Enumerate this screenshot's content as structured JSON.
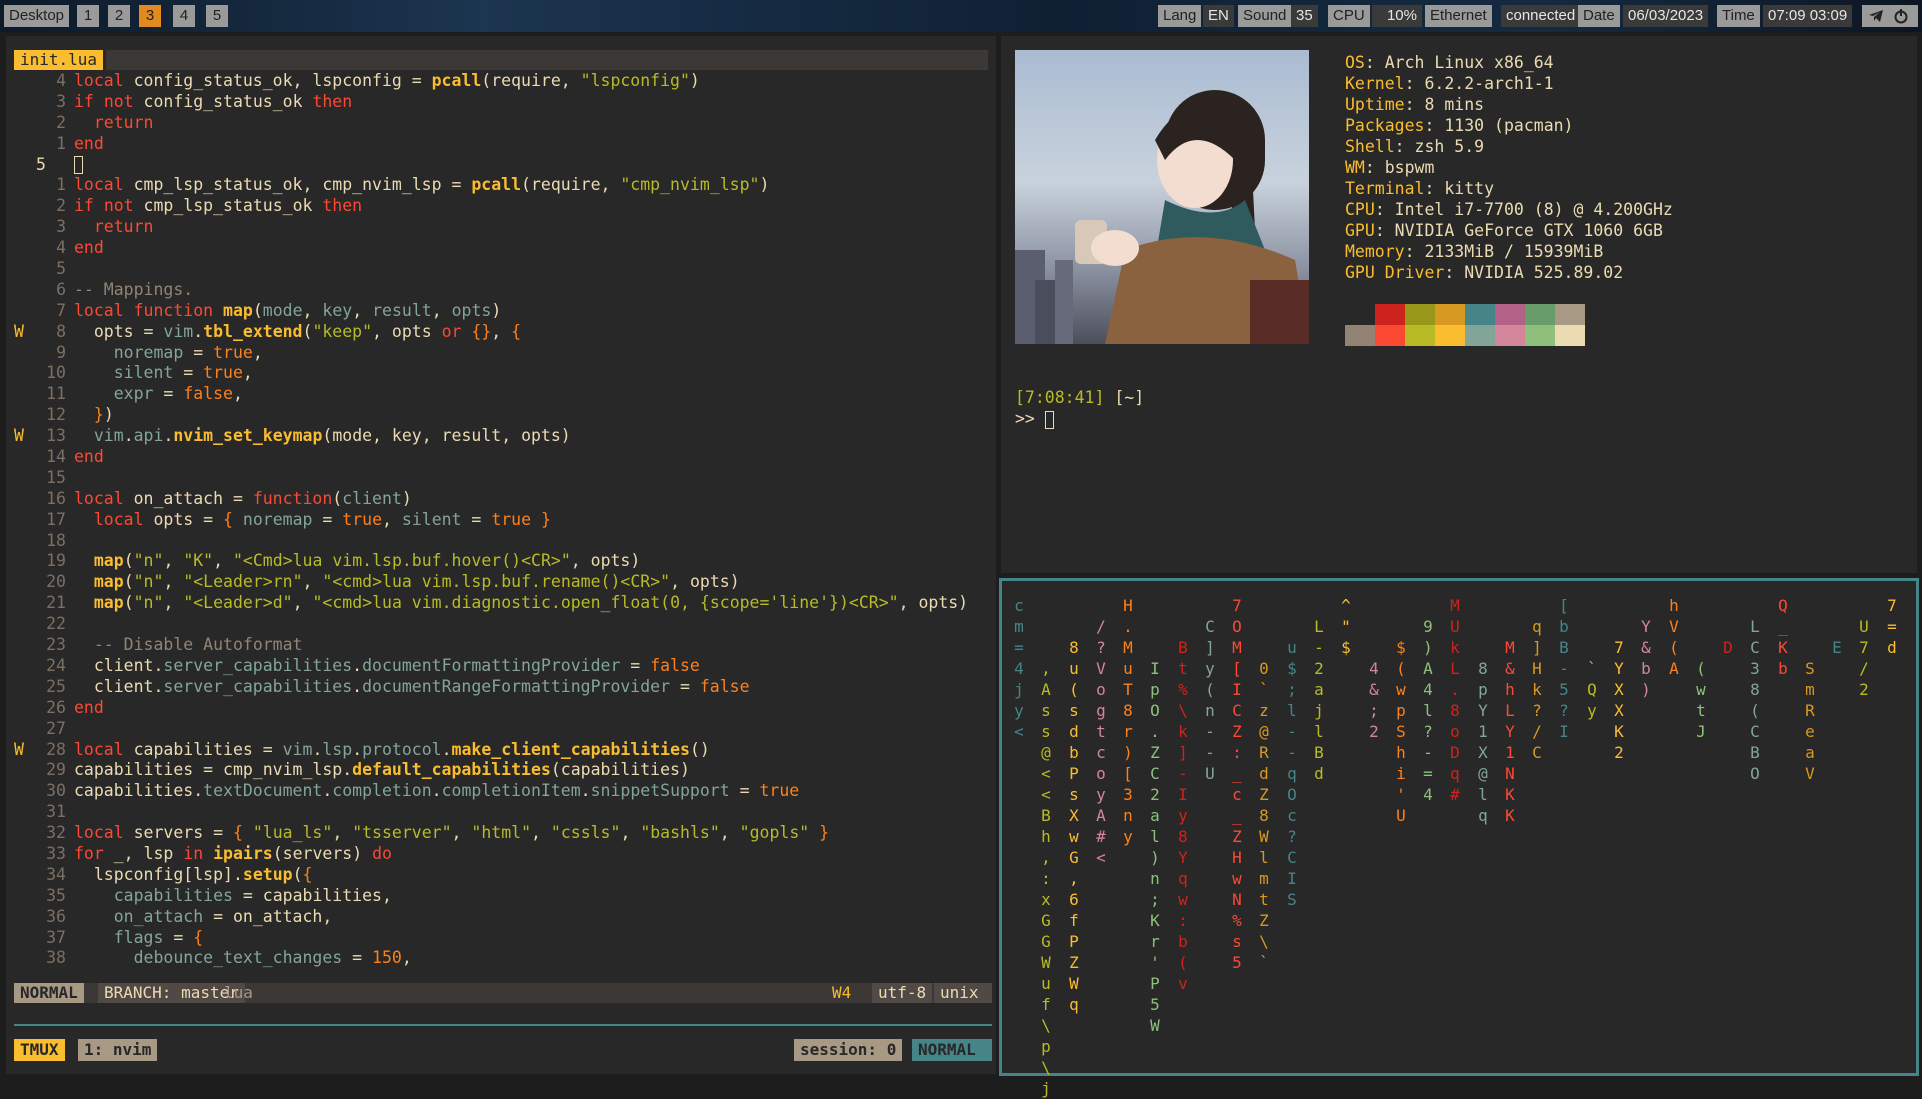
{
  "topbar": {
    "desktop_label": "Desktop",
    "workspaces": [
      "1",
      "2",
      "3",
      "4",
      "5"
    ],
    "active_workspace": "3",
    "lang_label": "Lang",
    "lang_value": "EN",
    "sound_label": "Sound",
    "sound_value": "35",
    "cpu_label": "CPU",
    "cpu_value": "10%",
    "net_label": "Ethernet",
    "net_value": "connected",
    "date_label": "Date",
    "date_value": "06/03/2023",
    "time_label": "Time",
    "time_value": "07:09 03:09",
    "tray_icons": [
      "telegram-icon",
      "power-icon"
    ]
  },
  "editor": {
    "tab_name": "init.lua",
    "lines": [
      {
        "sign": "",
        "num": "4",
        "html": "<span class='k'>local</span> config_status_ok, lspconfig = <span class='f'>pcall</span>(require, <span class='s'>\"lspconfig\"</span>)"
      },
      {
        "sign": "",
        "num": "3",
        "html": "<span class='k'>if</span> <span class='k'>not</span> config_status_ok <span class='k'>then</span>"
      },
      {
        "sign": "",
        "num": "2",
        "html": "  <span class='k'>return</span>"
      },
      {
        "sign": "",
        "num": "1",
        "html": "<span class='k'>end</span>"
      },
      {
        "sign": "",
        "num": "5",
        "cur": true,
        "html": "<span class='cursor'></span>"
      },
      {
        "sign": "",
        "num": "1",
        "html": "<span class='k'>local</span> cmp_lsp_status_ok, cmp_nvim_lsp = <span class='f'>pcall</span>(require, <span class='s'>\"cmp_nvim_lsp\"</span>)"
      },
      {
        "sign": "",
        "num": "2",
        "html": "<span class='k'>if</span> <span class='k'>not</span> cmp_lsp_status_ok <span class='k'>then</span>"
      },
      {
        "sign": "",
        "num": "3",
        "html": "  <span class='k'>return</span>"
      },
      {
        "sign": "",
        "num": "4",
        "html": "<span class='k'>end</span>"
      },
      {
        "sign": "",
        "num": "5",
        "html": ""
      },
      {
        "sign": "",
        "num": "6",
        "html": "<span class='c'>-- Mappings.</span>"
      },
      {
        "sign": "",
        "num": "7",
        "html": "<span class='k'>local</span> <span class='k'>function</span> <span class='f'>map</span>(<span class='p'>mode</span>, <span class='p'>key</span>, <span class='p'>result</span>, <span class='p'>opts</span>)"
      },
      {
        "sign": "W",
        "num": "8",
        "html": "  opts = <span class='p'>vim</span>.<span class='f'>tbl_extend</span>(<span class='s'>\"keep\"</span>, opts <span class='k'>or</span> <span class='b'>{}</span>, <span class='b'>{</span>"
      },
      {
        "sign": "",
        "num": "9",
        "html": "    <span class='p'>noremap</span> = <span class='b'>true</span>,"
      },
      {
        "sign": "",
        "num": "10",
        "html": "    <span class='p'>silent</span> = <span class='b'>true</span>,"
      },
      {
        "sign": "",
        "num": "11",
        "html": "    <span class='p'>expr</span> = <span class='b'>false</span>,"
      },
      {
        "sign": "",
        "num": "12",
        "html": "  <span class='b'>}</span>)"
      },
      {
        "sign": "W",
        "num": "13",
        "html": "  <span class='p'>vim</span>.<span class='p'>api</span>.<span class='f'>nvim_set_keymap</span>(mode, key, result, opts)"
      },
      {
        "sign": "",
        "num": "14",
        "html": "<span class='k'>end</span>"
      },
      {
        "sign": "",
        "num": "15",
        "html": ""
      },
      {
        "sign": "",
        "num": "16",
        "html": "<span class='k'>local</span> on_attach = <span class='k'>function</span>(<span class='p'>client</span>)"
      },
      {
        "sign": "",
        "num": "17",
        "html": "  <span class='k'>local</span> opts = <span class='b'>{</span> <span class='p'>noremap</span> = <span class='b'>true</span>, <span class='p'>silent</span> = <span class='b'>true</span> <span class='b'>}</span>"
      },
      {
        "sign": "",
        "num": "18",
        "html": ""
      },
      {
        "sign": "",
        "num": "19",
        "html": "  <span class='f'>map</span>(<span class='s'>\"n\"</span>, <span class='s'>\"K\"</span>, <span class='s'>\"&lt;Cmd&gt;lua vim.lsp.buf.hover()&lt;CR&gt;\"</span>, opts)"
      },
      {
        "sign": "",
        "num": "20",
        "html": "  <span class='f'>map</span>(<span class='s'>\"n\"</span>, <span class='s'>\"&lt;Leader&gt;rn\"</span>, <span class='s'>\"&lt;cmd&gt;lua vim.lsp.buf.rename()&lt;CR&gt;\"</span>, opts)"
      },
      {
        "sign": "",
        "num": "21",
        "html": "  <span class='f'>map</span>(<span class='s'>\"n\"</span>, <span class='s'>\"&lt;Leader&gt;d\"</span>, <span class='s'>\"&lt;cmd&gt;lua vim.diagnostic.open_float(0, {scope='line'})&lt;CR&gt;\"</span>, opts)"
      },
      {
        "sign": "",
        "num": "22",
        "html": ""
      },
      {
        "sign": "",
        "num": "23",
        "html": "  <span class='c'>-- Disable Autoformat</span>"
      },
      {
        "sign": "",
        "num": "24",
        "html": "  client.<span class='p'>server_capabilities</span>.<span class='p'>documentFormattingProvider</span> = <span class='b'>false</span>"
      },
      {
        "sign": "",
        "num": "25",
        "html": "  client.<span class='p'>server_capabilities</span>.<span class='p'>documentRangeFormattingProvider</span> = <span class='b'>false</span>"
      },
      {
        "sign": "",
        "num": "26",
        "html": "<span class='k'>end</span>"
      },
      {
        "sign": "",
        "num": "27",
        "html": ""
      },
      {
        "sign": "W",
        "num": "28",
        "html": "<span class='k'>local</span> capabilities = <span class='p'>vim</span>.<span class='p'>lsp</span>.<span class='p'>protocol</span>.<span class='f'>make_client_capabilities</span>()"
      },
      {
        "sign": "",
        "num": "29",
        "html": "capabilities = cmp_nvim_lsp.<span class='f'>default_capabilities</span>(capabilities)"
      },
      {
        "sign": "",
        "num": "30",
        "html": "capabilities.<span class='p'>textDocument</span>.<span class='p'>completion</span>.<span class='p'>completionItem</span>.<span class='p'>snippetSupport</span> = <span class='b'>true</span>"
      },
      {
        "sign": "",
        "num": "31",
        "html": ""
      },
      {
        "sign": "",
        "num": "32",
        "html": "<span class='k'>local</span> servers = <span class='b'>{</span> <span class='s'>\"lua_ls\"</span>, <span class='s'>\"tsserver\"</span>, <span class='s'>\"html\"</span>, <span class='s'>\"cssls\"</span>, <span class='s'>\"bashls\"</span>, <span class='s'>\"gopls\"</span> <span class='b'>}</span>"
      },
      {
        "sign": "",
        "num": "33",
        "html": "<span class='k'>for</span> _, lsp <span class='k'>in</span> <span class='f'>ipairs</span>(servers) <span class='k'>do</span>"
      },
      {
        "sign": "",
        "num": "34",
        "html": "  lspconfig[lsp].<span class='f'>setup</span>(<span class='b'>{</span>"
      },
      {
        "sign": "",
        "num": "35",
        "html": "    <span class='p'>capabilities</span> = capabilities,"
      },
      {
        "sign": "",
        "num": "36",
        "html": "    <span class='p'>on_attach</span> = on_attach,"
      },
      {
        "sign": "",
        "num": "37",
        "html": "    <span class='p'>flags</span> = <span class='b'>{</span>"
      },
      {
        "sign": "",
        "num": "38",
        "html": "      <span class='p'>debounce_text_changes</span> = <span class='b'>150</span>,"
      }
    ],
    "status": {
      "mode": "NORMAL",
      "branch": "BRANCH: master",
      "filetype": "lua",
      "warnings": "W4",
      "encoding": "utf-8",
      "format": "unix"
    }
  },
  "tmux": {
    "label": "TMUX",
    "window": "1: nvim",
    "session": "session: 0",
    "mode": "NORMAL"
  },
  "neofetch": {
    "info": [
      {
        "label": "OS",
        "value": "Arch Linux x86_64"
      },
      {
        "label": "Kernel",
        "value": "6.2.2-arch1-1"
      },
      {
        "label": "Uptime",
        "value": "8 mins"
      },
      {
        "label": "Packages",
        "value": "1130 (pacman)"
      },
      {
        "label": "Shell",
        "value": "zsh 5.9"
      },
      {
        "label": "WM",
        "value": "bspwm"
      },
      {
        "label": "Terminal",
        "value": "kitty"
      },
      {
        "label": "CPU",
        "value": "Intel i7-7700 (8) @ 4.200GHz"
      },
      {
        "label": "GPU",
        "value": "NVIDIA GeForce GTX 1060 6GB"
      },
      {
        "label": "Memory",
        "value": "2133MiB / 15939MiB"
      },
      {
        "label": "GPU Driver",
        "value": "NVIDIA 525.89.02"
      }
    ],
    "palette": [
      "#282828",
      "#cc241d",
      "#98971a",
      "#d79921",
      "#458588",
      "#b16286",
      "#689d6a",
      "#a89984",
      "#928374",
      "#fb4934",
      "#b8bb26",
      "#fabd2f",
      "#83a598",
      "#d3869b",
      "#8ec07c",
      "#ebdbb2"
    ],
    "prompt_time": "[7:08:41]",
    "prompt_dir": "[~]",
    "prompt_symbol": ">>"
  },
  "matrix": {
    "colors": [
      "#458588",
      "#b8bb26",
      "#fabd2f",
      "#d3869b",
      "#fe8019",
      "#8ec07c",
      "#cc241d",
      "#83a598",
      "#fb4934",
      "#d79921"
    ],
    "columns": [
      "cm=4jy<",
      ",Ass@<<Bh,:xGGWuf\\p\\j",
      "8u(sdbPsXwG,6fPZWq",
      "/?VogtcoyA#<",
      "H.MuT8r)[3ny",
      "IpO.ZC2al)n;Kr'P5W",
      "Bt%\\k]-Iy8Yqw:b(v",
      "C]y(n--U",
      "7OM[ICZ:_c_ZHwN%s5",
      "0`z@RdZ8WlmtZ\\`",
      "u$;l--qOc?CIS",
      "L-2ajlBd",
      "^\"$",
      "4&;2",
      "$(wpShi'U",
      "9)A4l?-=4",
      "MUkL.8oDq#",
      "8pY1X@lq",
      "M&hLY1NKK",
      "q]Hk?/C",
      "[bB-5?I",
      "`Qy",
      "7YXXK2",
      "Y&b)",
      "hV(A",
      "(wtJ",
      "D",
      "LC38(CBO",
      "Q_Kb",
      "SmReaV",
      "E",
      "U7/2",
      "7=d"
    ]
  }
}
